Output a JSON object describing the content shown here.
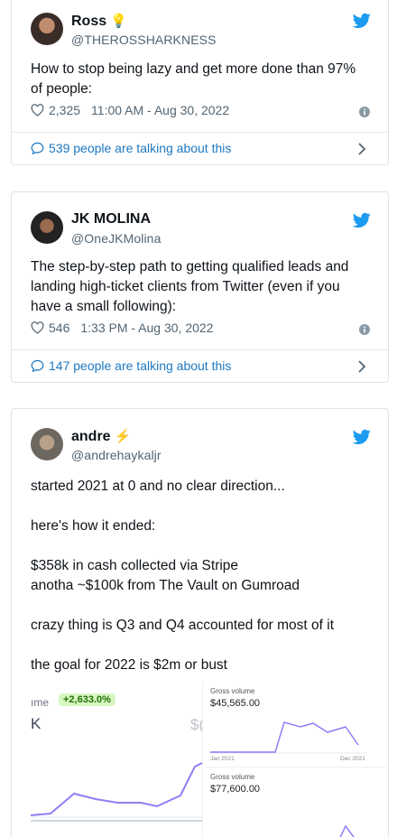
{
  "tweets": [
    {
      "name": "Ross",
      "badge": "💡",
      "handle": "@THEROSSHARKNESS",
      "text": [
        "How to stop being lazy and get more done than 97%",
        "of people:"
      ],
      "likes": "2,325",
      "timestamp": "11:00 AM - Aug 30, 2022",
      "talking": "539 people are talking about this"
    },
    {
      "name": "JK MOLINA",
      "badge": "",
      "handle": "@OneJKMolina",
      "text": [
        "The step-by-step path to getting qualified leads and",
        "landing high-ticket clients from Twitter (even if you",
        "have a small following):"
      ],
      "likes": "546",
      "timestamp": "1:33 PM - Aug 30, 2022",
      "talking": "147 people are talking about this"
    },
    {
      "name": "andre",
      "badge": "⚡",
      "handle": "@andrehaykaljr",
      "text": [
        "started 2021 at 0 and no clear direction...",
        "here's how it ended:",
        "$358k in cash collected via Stripe",
        "anotha ~$100k from The Vault on Gumroad",
        "crazy thing is Q3 and Q4 accounted for most of it",
        "the goal for 2022 is $2m or bust"
      ],
      "media": {
        "left_label": "ıme",
        "growth_chip": "+2,633.0%",
        "left_big": "K",
        "right_dollar": "$(",
        "gross_label_1": "Gross volume",
        "gross_value_1": "$45,565.00",
        "axis_start": "Jan 2021",
        "axis_end": "Dec 2021",
        "gross_label_2": "Gross volume",
        "gross_value_2": "$77,600.00"
      }
    }
  ],
  "colors": {
    "twitter_blue": "#1d9bf0",
    "link_blue": "#1d78c1",
    "chart_purple": "#8d7ff5",
    "chip_green_bg": "#d7f7c2"
  },
  "icons": [
    "twitter-bird-icon",
    "heart-icon",
    "info-icon",
    "speech-bubble-icon",
    "chevron-right-icon"
  ]
}
